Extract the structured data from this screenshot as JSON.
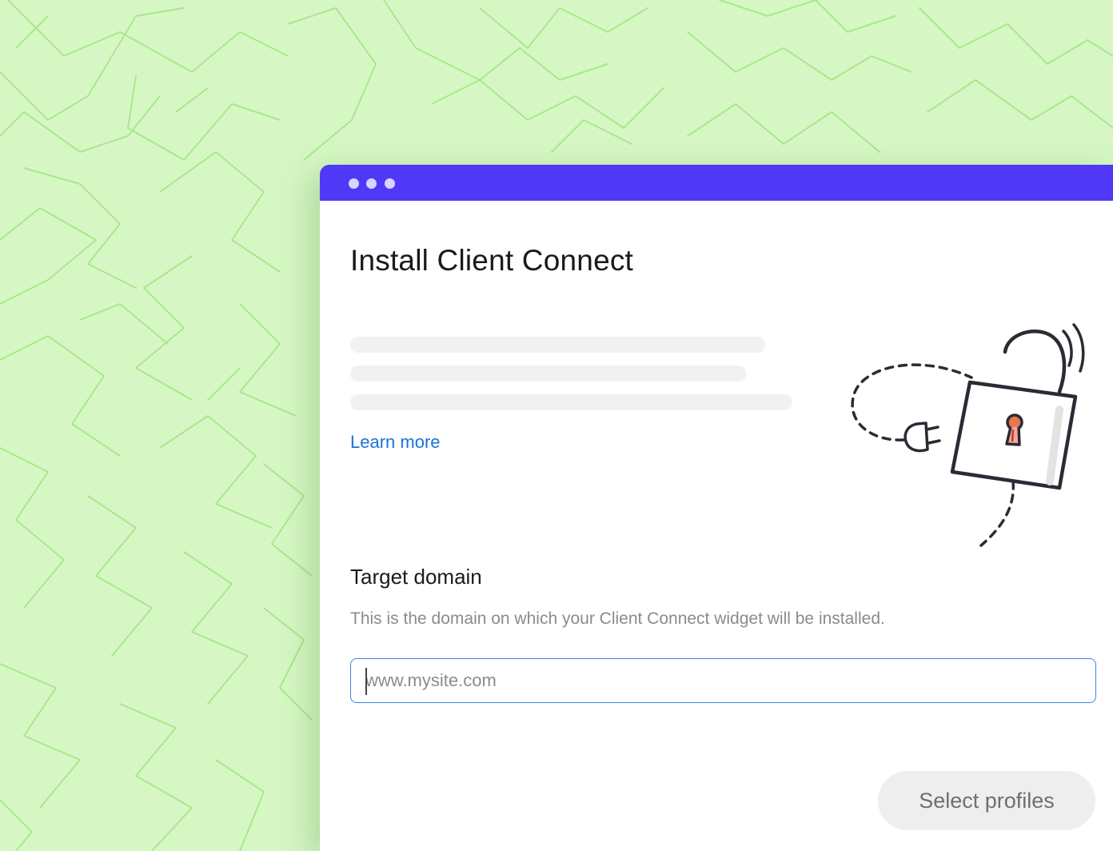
{
  "window": {
    "controls": [
      "dot",
      "dot",
      "dot"
    ]
  },
  "main": {
    "title": "Install Client Connect",
    "learn_more": "Learn more",
    "illustration_icon": "unlocked-padlock-plug-icon"
  },
  "domain_field": {
    "label": "Target domain",
    "help": "This is the domain on which your Client Connect widget will be installed.",
    "placeholder": "www.mysite.com",
    "value": ""
  },
  "actions": {
    "select_profiles": "Select profiles"
  },
  "colors": {
    "background": "#d6f7c3",
    "pattern_line": "#a8e88e",
    "titlebar": "#4f39f6",
    "link": "#1a73d9",
    "input_border": "#3d86dd",
    "button_bg": "#eeeeee"
  }
}
